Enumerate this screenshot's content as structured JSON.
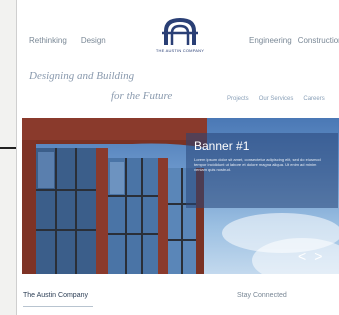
{
  "nav": {
    "left": [
      "Rethinking",
      "Design"
    ],
    "right": [
      "Engineering",
      "Construction"
    ]
  },
  "logo": {
    "mark": "A",
    "text": "THE AUSTIN COMPANY"
  },
  "tagline": {
    "line1": "Designing and Building",
    "line2": "for the Future"
  },
  "utility_links": [
    "Projects",
    "Our Services",
    "Careers"
  ],
  "banner": {
    "title": "Banner #1",
    "text": "Lorem ipsum dolor sit amet, consectetur adipiscing elit, sed do eiusmod tempor incididunt ut labore et dolore magna aliqua. Ut enim ad minim veniam quis nostrud."
  },
  "slider": {
    "prev": "<",
    "next": ">"
  },
  "footer": {
    "left": "The Austin Company",
    "right": "Stay Connected"
  },
  "colors": {
    "brand": "#2a3f75",
    "sky": "#6c98cc",
    "brick": "#8a3a2c"
  }
}
